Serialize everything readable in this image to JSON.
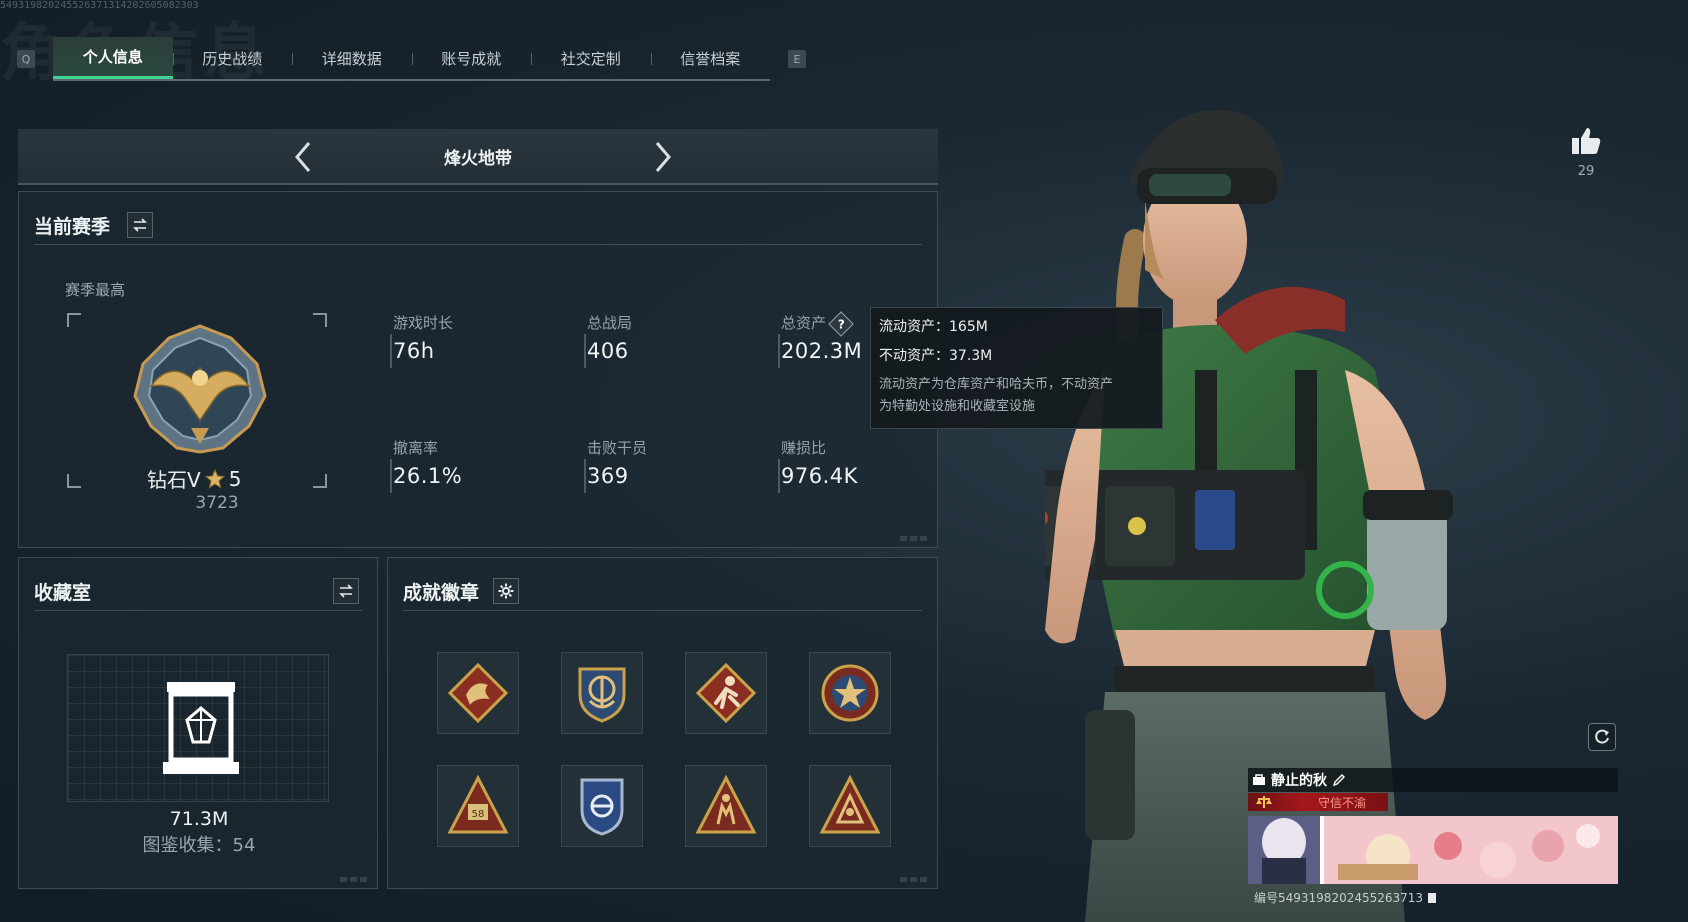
{
  "watermark": "549319820245526371314202605082303",
  "bg_title": "角色信息",
  "tabs": {
    "key_left": "Q",
    "key_right": "E",
    "items": [
      "个人信息",
      "历史战绩",
      "详细数据",
      "账号成就",
      "社交定制",
      "信誉档案"
    ],
    "active_index": 0
  },
  "mode": {
    "title": "烽火地带"
  },
  "season": {
    "title": "当前赛季",
    "subtitle": "赛季最高",
    "rank_name": "钻石V",
    "rank_stars": "5",
    "rank_score": "3723",
    "stats": [
      {
        "label": "游戏时长",
        "value": "76h"
      },
      {
        "label": "总战局",
        "value": "406"
      },
      {
        "label": "总资产",
        "value": "202.3M"
      },
      {
        "label": "撤离率",
        "value": "26.1%"
      },
      {
        "label": "击败干员",
        "value": "369"
      },
      {
        "label": "赚损比",
        "value": "976.4K"
      }
    ]
  },
  "tooltip": {
    "liquid": "流动资产：165M",
    "fixed": "不动资产：37.3M",
    "desc_line1": "流动资产为仓库资产和哈夫币，不动资产",
    "desc_line2": "为特勤处设施和收藏室设施"
  },
  "collection": {
    "title": "收藏室",
    "value": "71.3M",
    "count": "图鉴收集：54"
  },
  "achievements": {
    "title": "成就徽章",
    "badges": [
      "dragon-badge",
      "anchor-badge",
      "runner-badge",
      "star-badge",
      "number-58-badge",
      "shield-badge",
      "figures-badge",
      "triangle-badge"
    ]
  },
  "like": {
    "count": "29"
  },
  "player_card": {
    "name": "静止的秋",
    "reputation": "守信不渝",
    "id_text": "编号5493198202455263713"
  },
  "colors": {
    "accent_green": "#3fd191",
    "rep_red": "#a4171b",
    "gold": "#c9a24a"
  }
}
